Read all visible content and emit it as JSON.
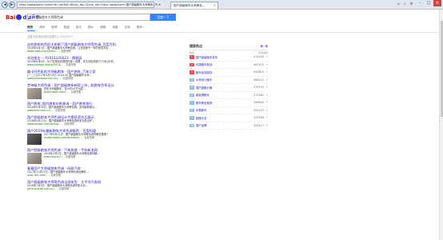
{
  "browser": {
    "address": "https://www.baidu.com/s?ie=utf-8&f=8&rsv_bp=1&rsv_idx=1&tn=baidu&wd=国产超级跑车大师等色调",
    "tab_label": "国产超级跑车大师等色...",
    "close_glyph": "×",
    "nav_back": "◀",
    "nav_forward": "▶",
    "addr_tools": "⟳ ▾",
    "tool_icons": "⌂ ☆ ⚙",
    "win_min": "–",
    "win_max": "□",
    "win_close": "×"
  },
  "header": {
    "logo_bai": "Bai",
    "logo_du": "du",
    "logo_cn": "百度",
    "query": "国产超级跑车大师等色调",
    "search_label": "百度一下"
  },
  "nav": {
    "tabs": [
      "网页",
      "资讯",
      "贴吧",
      "知道",
      "音乐",
      "图片",
      "视频",
      "地图",
      "文库",
      "更多»"
    ]
  },
  "result_count": "百度为您找到相关结果约1,250,000个",
  "results": [
    {
      "title": "这些跑车的色彩太抢眼了国产超级跑车大师等色调_百度百科",
      "abs": "2016年4月3日 - 国产超级跑车大师等色调，让您感受不一样的视觉冲击...",
      "url": "baike.baidu.com/item/...",
      "snap": "百度快照"
    },
    {
      "title": "实验报告 -- P2014240023 - 博客园",
      "abs": "2015年6月6日 - 为了实现色彩搭配的统一效果，本文对色调进行了对比分析...",
      "url": "www.cnblogs.com/p/2014/...",
      "snap": "百度快照"
    },
    {
      "title": "趣卡阿色彩的大师级跑车 - 国产跑车_汽车之家",
      "abs": "[一二三]2017年5月19日 10:54:44 国产超级跑车大师...",
      "url": "www.autohome.com.cn/...",
      "snap": "百度快照"
    },
    {
      "title": "赏神级大师色调 - 国产超级跑车新款上市，超跑车色系设计",
      "abs": "色彩大师级跑车，售价约50万元起...",
      "url": "baike.baidu.com/...",
      "snap": "百度快照",
      "thumb": true
    },
    {
      "title": "国产跑车_国内跑车价格查询 - 国产跑车排行",
      "abs": "2016年5月16日 - 国产超级跑车大师等色调，查询最新报价...",
      "url": "www.xcar.com.cn/...",
      "snap": "百度快照"
    },
    {
      "title": "国产超级跑车大师色调设计大赛获奖作品展示",
      "abs": "2016年4月11日 - 国产超级跑车大师等色调获奖作品出炉...",
      "url": "www.douban.com/group/...",
      "snap": "百度快照"
    },
    {
      "title": "国产2019年最新跑车大师色调推荐 - 百度知道",
      "abs": "2017年9月12日 - 国产超级跑车大师等色调有哪些推荐？",
      "url": "zhidao.baidu.com/question/...",
      "snap": "百度快照",
      "thumb": true,
      "dark": true
    },
    {
      "title": "国产超级跑车大师色调 - 汽车频道 - 手机新浪网",
      "abs": "2018年3月2日 - 国产超级跑车大师等色调详解...",
      "url": "auto.sina.cn/...",
      "snap": "百度快照",
      "thumb": true
    },
    {
      "title": "看看国产大师级跑车色调 - 网易汽车",
      "abs": "2017年11月21日 - 国产超级跑车大师等色调全解析...",
      "url": "auto.163.com/...",
      "snap": "百度快照"
    },
    {
      "title": "国产超级跑车大师等色调全部车型 - 太平洋汽车网",
      "abs": "2016年7月9日 - 国产超级跑车大师等色调车型大全...",
      "url": "price.pcauto.com.cn/...",
      "snap": "百度快照"
    }
  ],
  "hot": {
    "title": "搜索热点",
    "sub": "换一换",
    "head_left": "排名",
    "head_right": "搜索指数",
    "items": [
      {
        "rank": "1",
        "name": "国产超级跑车发布",
        "value": "474200",
        "trend": "↑"
      },
      {
        "rank": "2",
        "name": "中国跑车新品",
        "value": "467410",
        "trend": "↑"
      },
      {
        "rank": "3",
        "name": "跑车色调选择",
        "value": "420810",
        "trend": "↑"
      },
      {
        "rank": "4",
        "name": "大师设计跑车",
        "value": "386212",
        "trend": "↑"
      },
      {
        "rank": "5",
        "name": "国产超跑价格",
        "value": "379153",
        "trend": "↑"
      },
      {
        "rank": "6",
        "name": "新能源跑车",
        "value": "372361",
        "trend": "↑"
      },
      {
        "rank": "7",
        "name": "跑车配色推荐",
        "value": "359634",
        "trend": "↑"
      },
      {
        "rank": "8",
        "name": "车展新车",
        "value": "352125",
        "trend": "↑"
      },
      {
        "rank": "9",
        "name": "超跑大赏",
        "value": "337456",
        "trend": "↑"
      },
      {
        "rank": "10",
        "name": "国产品牌",
        "value": "325117",
        "trend": "↑"
      }
    ]
  }
}
